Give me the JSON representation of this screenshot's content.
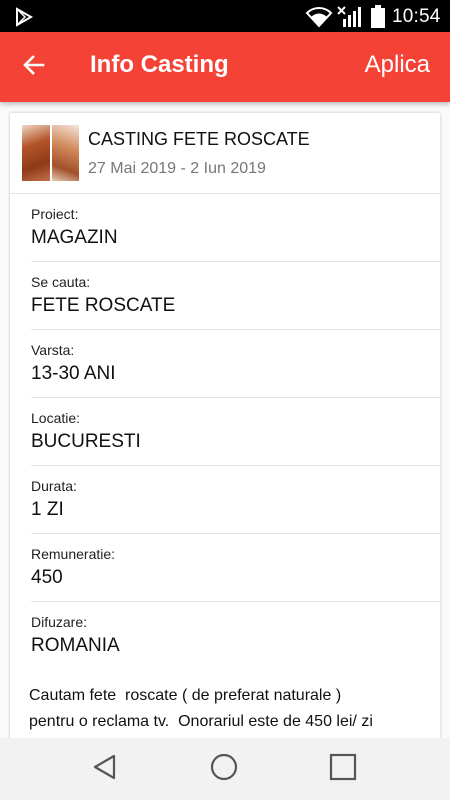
{
  "status_bar": {
    "time": "10:54",
    "icons": [
      "play-store-icon",
      "wifi-icon",
      "signal-icon",
      "battery-icon"
    ]
  },
  "app_bar": {
    "title": "Info Casting",
    "action_label": "Aplica",
    "color": "#f44336",
    "back_icon": "arrow-left-icon"
  },
  "casting": {
    "title": "CASTING FETE ROSCATE",
    "dates": "27 Mai 2019 - 2 Iun 2019",
    "fields": [
      {
        "label": "Proiect:",
        "value": "MAGAZIN"
      },
      {
        "label": "Se cauta:",
        "value": "FETE ROSCATE"
      },
      {
        "label": "Varsta:",
        "value": "13-30 ANI"
      },
      {
        "label": "Locatie:",
        "value": "BUCURESTI"
      },
      {
        "label": "Durata:",
        "value": "1 ZI"
      },
      {
        "label": "Remuneratie:",
        "value": "450"
      },
      {
        "label": "Difuzare:",
        "value": "ROMANIA"
      }
    ],
    "description": "Cautam fete  roscate ( de preferat naturale )\npentru o reclama tv.  Onorariul este de 450 lei/ zi"
  },
  "nav_bar": {
    "buttons": [
      "back-triangle-icon",
      "home-circle-icon",
      "recents-square-icon"
    ]
  }
}
